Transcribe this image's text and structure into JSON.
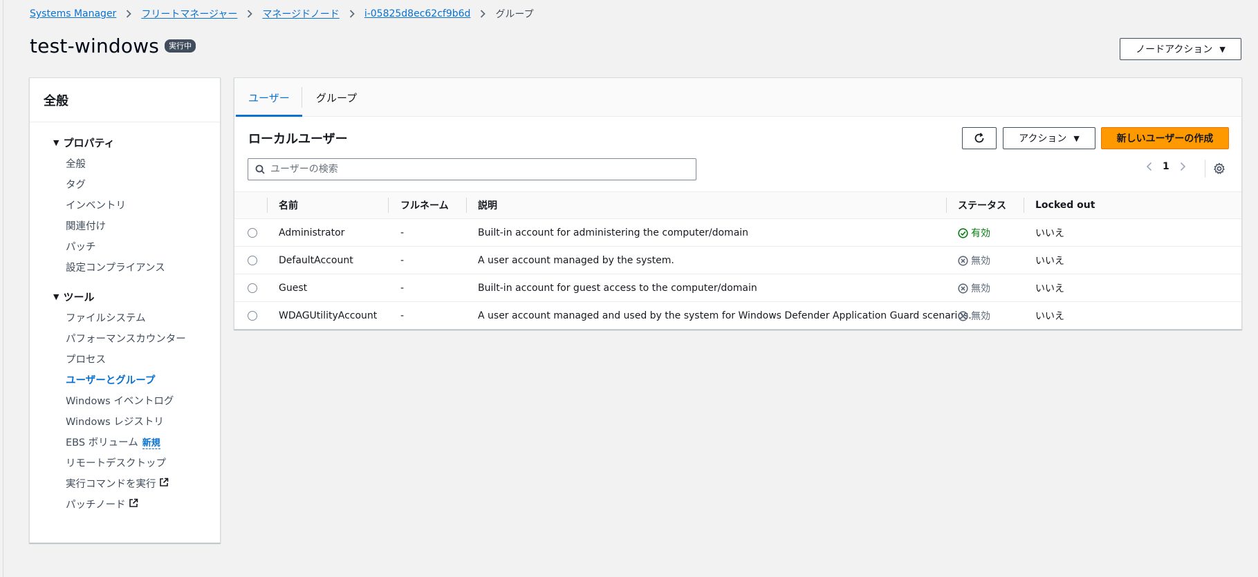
{
  "breadcrumb": {
    "items": [
      "Systems Manager",
      "フリートマネージャー",
      "マネージドノード",
      "i-05825d8ec62cf9b6d"
    ],
    "current": "グループ"
  },
  "header": {
    "title": "test-windows",
    "status": "実行中",
    "node_action_label": "ノードアクション"
  },
  "sidebar": {
    "title": "全般",
    "sections": [
      {
        "title": "プロパティ",
        "items": [
          "全般",
          "タグ",
          "インベントリ",
          "関連付け",
          "パッチ",
          "設定コンプライアンス"
        ]
      },
      {
        "title": "ツール",
        "items": [
          "ファイルシステム",
          "パフォーマンスカウンター",
          "プロセス",
          "ユーザーとグループ",
          "Windows イベントログ",
          "Windows レジストリ",
          "EBS ボリューム",
          "リモートデスクトップ",
          "実行コマンドを実行",
          "パッチノード"
        ]
      }
    ],
    "new_badge": "新規"
  },
  "tabs": [
    "ユーザー",
    "グループ"
  ],
  "main": {
    "section_title": "ローカルユーザー",
    "action_label": "アクション",
    "create_label": "新しいユーザーの作成",
    "search_placeholder": "ユーザーの検索",
    "page_number": "1"
  },
  "table": {
    "columns": [
      "名前",
      "フルネーム",
      "説明",
      "ステータス",
      "Locked out"
    ],
    "rows": [
      {
        "name": "Administrator",
        "fullname": "-",
        "description": "Built-in account for administering the computer/domain",
        "status": "有効",
        "locked": "いいえ"
      },
      {
        "name": "DefaultAccount",
        "fullname": "-",
        "description": "A user account managed by the system.",
        "status": "無効",
        "locked": "いいえ"
      },
      {
        "name": "Guest",
        "fullname": "-",
        "description": "Built-in account for guest access to the computer/domain",
        "status": "無効",
        "locked": "いいえ"
      },
      {
        "name": "WDAGUtilityAccount",
        "fullname": "-",
        "description": "A user account managed and used by the system for Windows Defender Application Guard scenarios.",
        "status": "無効",
        "locked": "いいえ"
      }
    ]
  },
  "colors": {
    "link": "#0972d3",
    "primary_button": "#ff9900",
    "enabled": "#037f0c",
    "disabled": "#5f6b7a"
  }
}
